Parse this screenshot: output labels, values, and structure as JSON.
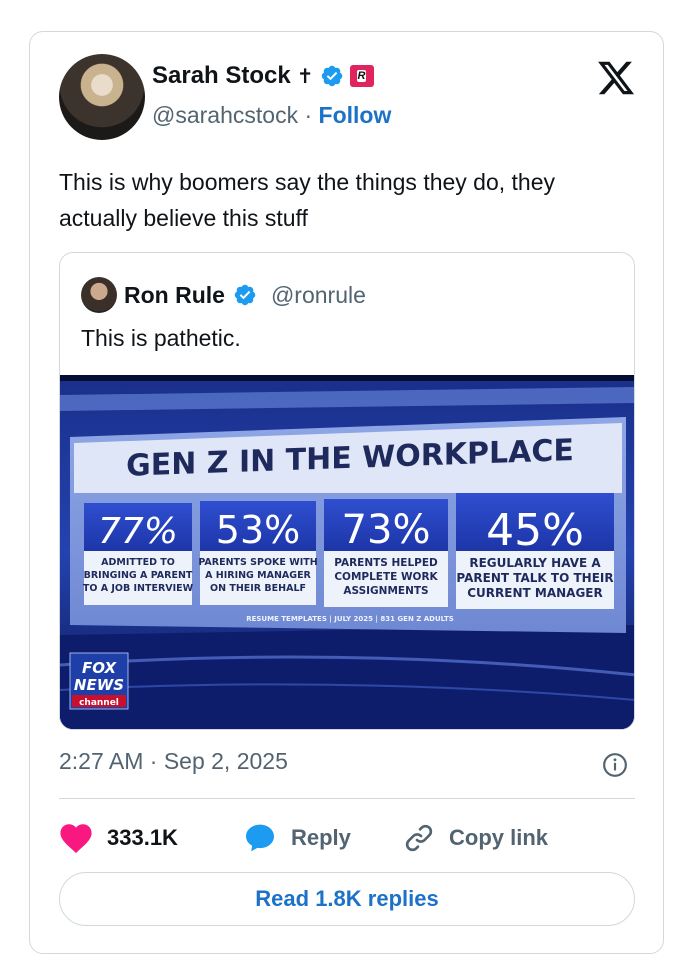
{
  "author": {
    "display_name": "Sarah Stock",
    "name_suffix_symbol": "✝",
    "handle": "@sarahcstock",
    "separator": "·",
    "follow_label": "Follow",
    "verified_color": "#1d9bf0",
    "badge_text": "R"
  },
  "tweet": {
    "text": "This is why boomers say the things they do, they actually believe this stuff",
    "timestamp": "2:27 AM · Sep 2, 2025"
  },
  "quoted_tweet": {
    "display_name": "Ron Rule",
    "handle": "@ronrule",
    "text": "This is pathetic.",
    "image": {
      "headline": "GEN Z IN THE WORKPLACE",
      "stats": [
        {
          "value": "77%",
          "caption_lines": [
            "ADMITTED TO",
            "BRINGING A PARENT",
            "TO A JOB INTERVIEW"
          ]
        },
        {
          "value": "53%",
          "caption_lines": [
            "PARENTS SPOKE WITH",
            "A HIRING MANAGER",
            "ON THEIR BEHALF"
          ]
        },
        {
          "value": "73%",
          "caption_lines": [
            "PARENTS HELPED",
            "COMPLETE WORK",
            "ASSIGNMENTS"
          ]
        },
        {
          "value": "45%",
          "caption_lines": [
            "REGULARLY HAVE A",
            "PARENT TALK TO THEIR",
            "CURRENT MANAGER"
          ]
        }
      ],
      "source_line": "RESUME TEMPLATES | JULY 2025 | 831 GEN Z ADULTS",
      "network_logo": [
        "FOX",
        "NEWS",
        "channel"
      ]
    }
  },
  "actions": {
    "likes_count": "333.1K",
    "reply_label": "Reply",
    "copy_link_label": "Copy link",
    "read_replies_label": "Read 1.8K replies"
  },
  "colors": {
    "like": "#f91880",
    "reply": "#1d9bf0",
    "link_blue": "#1d72c8",
    "muted_text": "#536471",
    "border": "#cfd9de"
  }
}
